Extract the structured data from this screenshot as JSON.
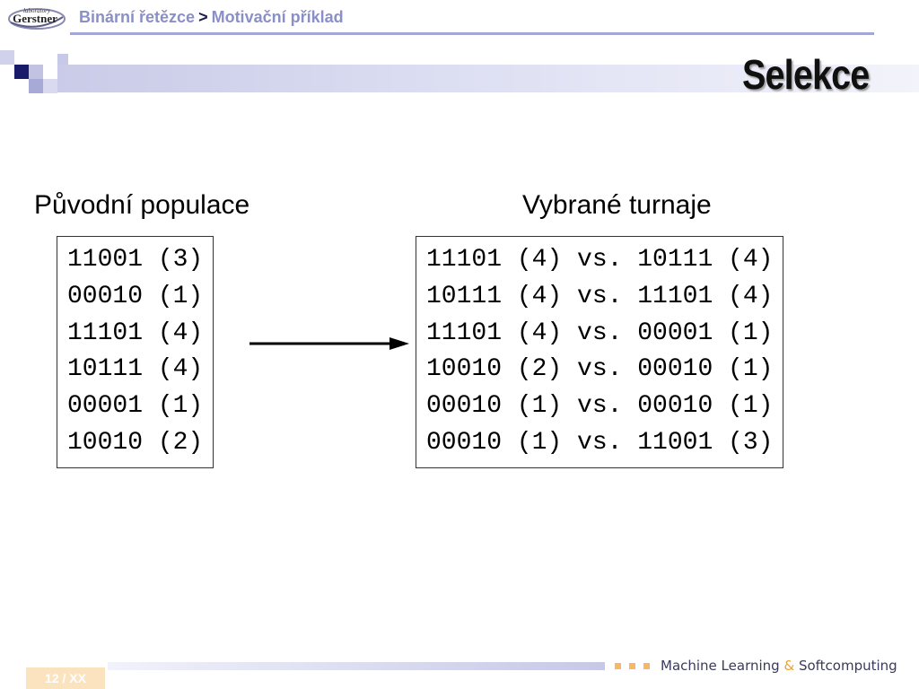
{
  "header": {
    "logo": {
      "line1": "laboratory",
      "line2": "Gerstner"
    },
    "breadcrumb": {
      "part1": "Binární řetězce",
      "separator": ">",
      "part2": "Motivační příklad"
    }
  },
  "slide": {
    "title": "Selekce",
    "left_heading": "Původní populace",
    "right_heading": "Vybrané turnaje",
    "population": [
      "11001 (3)",
      "00010 (1)",
      "11101 (4)",
      "10111 (4)",
      "00001 (1)",
      "10010 (2)"
    ],
    "tournaments": [
      "11101 (4) vs. 10111 (4)",
      "10111 (4) vs. 11101 (4)",
      "11101 (4) vs. 00001 (1)",
      "10010 (2) vs. 00010 (1)",
      "00010 (1) vs. 00010 (1)",
      "00010 (1) vs. 11001 (3)"
    ]
  },
  "footer": {
    "page": "12 / XX",
    "course_part1": "Machine Learning",
    "amp": "&",
    "course_part2": "Softcomputing"
  },
  "colors": {
    "breadcrumb": "#8b8fc8",
    "accent_navy": "#1a1a6a",
    "accent_lavender": "#a4a6d6",
    "footer_orange": "#f7b766"
  },
  "icons": {
    "arrow": "right-arrow-icon",
    "logo": "gerstner-logo"
  }
}
